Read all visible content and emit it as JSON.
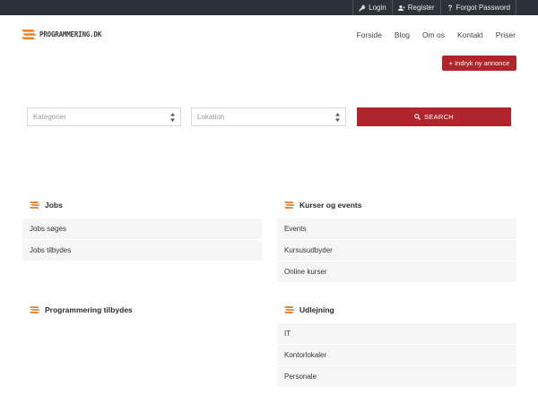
{
  "topbar": {
    "links": [
      {
        "label": "Login",
        "icon": "key-icon"
      },
      {
        "label": "Register",
        "icon": "add-user-icon"
      },
      {
        "label": "Forgot Password",
        "icon": "question-icon"
      }
    ]
  },
  "header": {
    "logo_text": "PROGRAMMERING.DK",
    "nav": [
      "Forside",
      "Blog",
      "Om os",
      "Kontakt",
      "Priser"
    ]
  },
  "post_button": "+ Indryk ny annonce",
  "search": {
    "category_placeholder": "Kategorier",
    "location_placeholder": "Lokation",
    "button_label": "SEARCH"
  },
  "categories": [
    {
      "title": "Jobs",
      "items": [
        "Jobs søges",
        "Jobs tilbydes"
      ]
    },
    {
      "title": "Kurser og events",
      "items": [
        "Events",
        "Kursusudbyder",
        "Online kurser"
      ]
    },
    {
      "title": "Programmering tilbydes",
      "items": []
    },
    {
      "title": "Udlejning",
      "items": [
        "IT",
        "Kontorlokaler",
        "Personale"
      ]
    }
  ],
  "colors": {
    "accent": "#b0242b",
    "topbar": "#2c3239",
    "logo_orange": "#e8822a"
  }
}
